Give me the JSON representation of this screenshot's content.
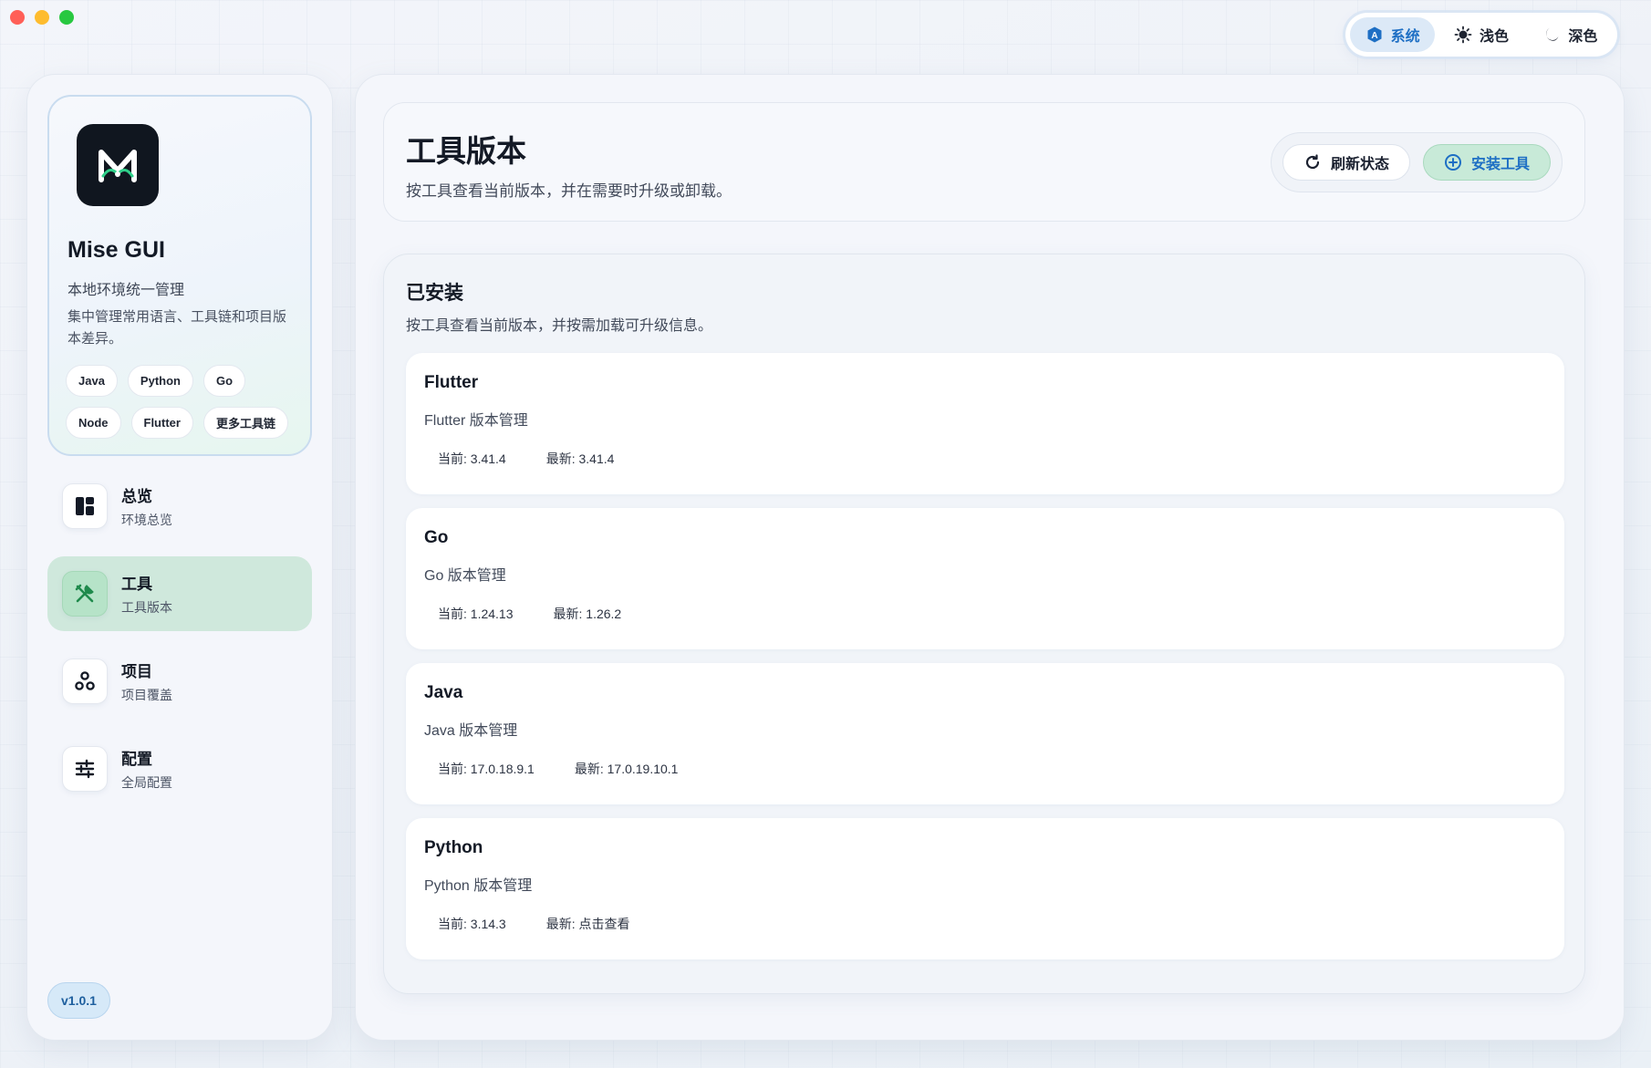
{
  "theme": {
    "options": [
      {
        "label": "系统",
        "icon": "system-theme-icon",
        "active": true
      },
      {
        "label": "浅色",
        "icon": "sun-icon",
        "active": false
      },
      {
        "label": "深色",
        "icon": "moon-icon",
        "active": false
      }
    ]
  },
  "brand": {
    "name": "Mise GUI",
    "subtitle": "本地环境统一管理",
    "description": "集中管理常用语言、工具链和项目版本差异。",
    "chips": [
      "Java",
      "Python",
      "Go",
      "Node",
      "Flutter",
      "更多工具链"
    ]
  },
  "nav": [
    {
      "title": "总览",
      "sub": "环境总览",
      "icon": "dashboard-icon",
      "active": false
    },
    {
      "title": "工具",
      "sub": "工具版本",
      "icon": "tools-icon",
      "active": true
    },
    {
      "title": "项目",
      "sub": "项目覆盖",
      "icon": "projects-icon",
      "active": false
    },
    {
      "title": "配置",
      "sub": "全局配置",
      "icon": "sliders-icon",
      "active": false
    }
  ],
  "version": "v1.0.1",
  "header": {
    "title": "工具版本",
    "subtitle": "按工具查看当前版本，并在需要时升级或卸载。",
    "refresh_label": "刷新状态",
    "install_label": "安装工具"
  },
  "installed": {
    "title": "已安装",
    "subtitle": "按工具查看当前版本，并按需加载可升级信息。",
    "tools": [
      {
        "name": "Flutter",
        "desc": "Flutter 版本管理",
        "current": "当前: 3.41.4",
        "latest": "最新: 3.41.4"
      },
      {
        "name": "Go",
        "desc": "Go 版本管理",
        "current": "当前: 1.24.13",
        "latest": "最新: 1.26.2"
      },
      {
        "name": "Java",
        "desc": "Java 版本管理",
        "current": "当前: 17.0.18.9.1",
        "latest": "最新: 17.0.19.10.1"
      },
      {
        "name": "Python",
        "desc": "Python 版本管理",
        "current": "当前: 3.14.3",
        "latest": "最新: 点击查看"
      }
    ]
  },
  "colors": {
    "accent_blue": "#1e6fc4",
    "active_green": "#cfe8dc",
    "traffic_red": "#ff5f57",
    "traffic_yellow": "#febc2e",
    "traffic_green": "#28c840"
  }
}
